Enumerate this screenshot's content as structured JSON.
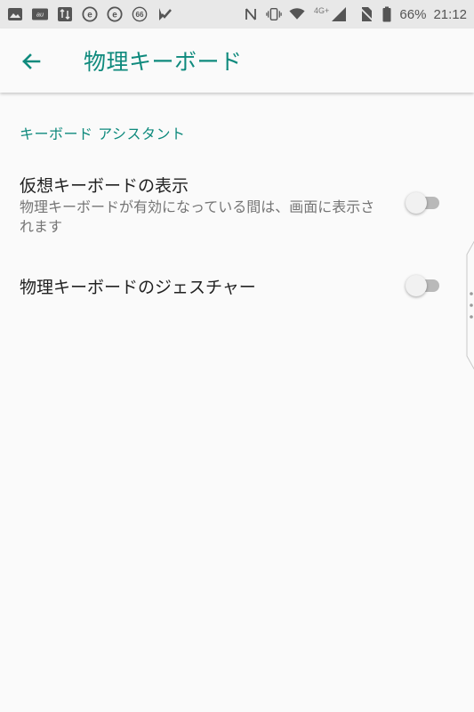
{
  "status_bar": {
    "left_icons": [
      "photo-icon",
      "au-icon",
      "transfer-icon",
      "e-icon",
      "e-icon",
      "66-icon",
      "check-app-icon"
    ],
    "network": "4G+",
    "battery": "66%",
    "time": "21:12"
  },
  "toolbar": {
    "title": "物理キーボード"
  },
  "section": {
    "header": "キーボード アシスタント"
  },
  "settings": [
    {
      "title": "仮想キーボードの表示",
      "summary": "物理キーボードが有効になっている間は、画面に表示されます",
      "enabled": false
    },
    {
      "title": "物理キーボードのジェスチャー",
      "enabled": false
    }
  ],
  "colors": {
    "accent": "#0f8a7d",
    "background": "#fafafa",
    "status_bar": "#e8e8e8"
  }
}
